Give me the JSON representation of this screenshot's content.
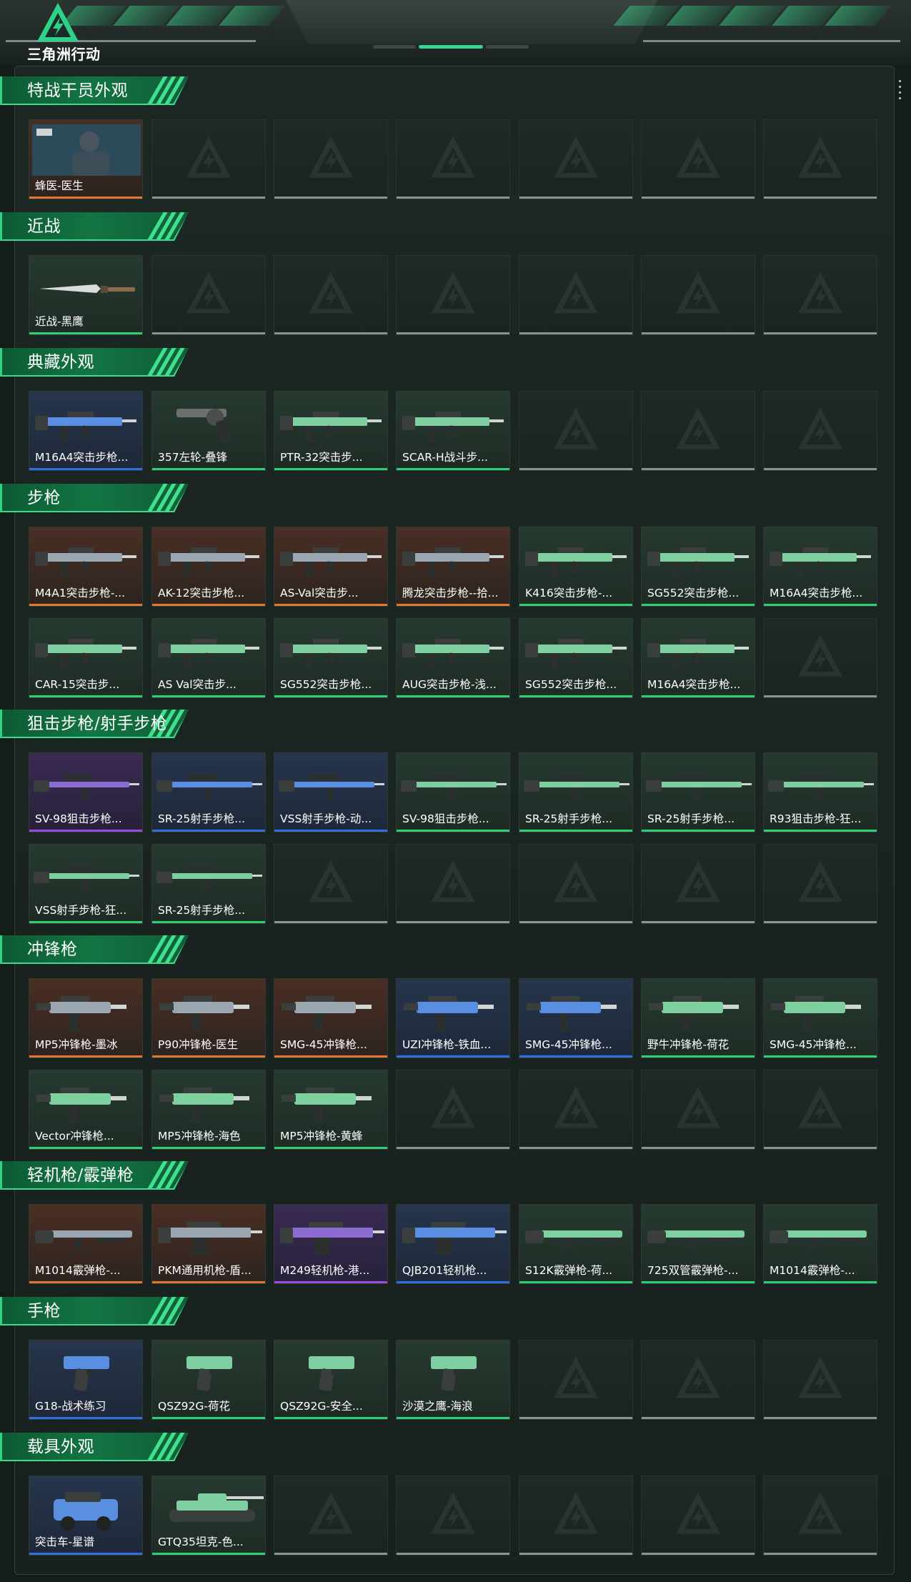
{
  "app": {
    "logo_text": "三角洲行动"
  },
  "colors": {
    "accent": "#37d38f",
    "quality_orange": "#e2782f",
    "quality_purple": "#9b4ce0",
    "quality_blue": "#2f6fe0",
    "quality_green": "#2fcf7a",
    "empty_bar": "#8a9590"
  },
  "sections": [
    {
      "title": "特战干员外观",
      "rows": [
        [
          {
            "name": "蜂医-医生",
            "q": "orange",
            "icon": "operator-portrait"
          },
          null,
          null,
          null,
          null,
          null,
          null
        ]
      ]
    },
    {
      "title": "近战",
      "rows": [
        [
          {
            "name": "近战-黑鹰",
            "q": "green",
            "icon": "knife-icon"
          },
          null,
          null,
          null,
          null,
          null,
          null
        ]
      ]
    },
    {
      "title": "典藏外观",
      "rows": [
        [
          {
            "name": "M16A4突击步枪...",
            "q": "blue",
            "icon": "rifle-icon"
          },
          {
            "name": "357左轮-叠锋",
            "q": "green",
            "icon": "revolver-icon"
          },
          {
            "name": "PTR-32突击步...",
            "q": "green",
            "icon": "rifle-icon"
          },
          {
            "name": "SCAR-H战斗步...",
            "q": "green",
            "icon": "rifle-icon"
          },
          null,
          null,
          null
        ]
      ]
    },
    {
      "title": "步枪",
      "rows": [
        [
          {
            "name": "M4A1突击步枪-...",
            "q": "orange",
            "icon": "rifle-icon"
          },
          {
            "name": "AK-12突击步枪...",
            "q": "orange",
            "icon": "rifle-icon"
          },
          {
            "name": "AS-Val突击步...",
            "q": "orange",
            "icon": "rifle-icon"
          },
          {
            "name": "腾龙突击步枪--拾...",
            "q": "orange",
            "icon": "rifle-icon"
          },
          {
            "name": "K416突击步枪-...",
            "q": "green",
            "icon": "rifle-icon"
          },
          {
            "name": "SG552突击步枪...",
            "q": "green",
            "icon": "rifle-icon"
          },
          {
            "name": "M16A4突击步枪...",
            "q": "green",
            "icon": "rifle-icon"
          }
        ],
        [
          {
            "name": "CAR-15突击步...",
            "q": "green",
            "icon": "rifle-icon"
          },
          {
            "name": "AS Val突击步...",
            "q": "green",
            "icon": "rifle-icon"
          },
          {
            "name": "SG552突击步枪...",
            "q": "green",
            "icon": "rifle-icon"
          },
          {
            "name": "AUG突击步枪-浅...",
            "q": "green",
            "icon": "rifle-icon"
          },
          {
            "name": "SG552突击步枪...",
            "q": "green",
            "icon": "rifle-icon"
          },
          {
            "name": "M16A4突击步枪...",
            "q": "green",
            "icon": "rifle-icon"
          },
          null
        ]
      ]
    },
    {
      "title": "狙击步枪/射手步枪",
      "rows": [
        [
          {
            "name": "SV-98狙击步枪...",
            "q": "purple",
            "icon": "sniper-icon"
          },
          {
            "name": "SR-25射手步枪...",
            "q": "blue",
            "icon": "sniper-icon"
          },
          {
            "name": "VSS射手步枪-动...",
            "q": "blue",
            "icon": "sniper-icon"
          },
          {
            "name": "SV-98狙击步枪...",
            "q": "green",
            "icon": "sniper-icon"
          },
          {
            "name": "SR-25射手步枪...",
            "q": "green",
            "icon": "sniper-icon"
          },
          {
            "name": "SR-25射手步枪...",
            "q": "green",
            "icon": "sniper-icon"
          },
          {
            "name": "R93狙击步枪-狂...",
            "q": "green",
            "icon": "sniper-icon"
          }
        ],
        [
          {
            "name": "VSS射手步枪-狂...",
            "q": "green",
            "icon": "sniper-icon"
          },
          {
            "name": "SR-25射手步枪...",
            "q": "green",
            "icon": "sniper-icon"
          },
          null,
          null,
          null,
          null,
          null
        ]
      ]
    },
    {
      "title": "冲锋枪",
      "rows": [
        [
          {
            "name": "MP5冲锋枪-墨冰",
            "q": "orange",
            "icon": "smg-icon"
          },
          {
            "name": "P90冲锋枪-医生",
            "q": "orange",
            "icon": "smg-icon"
          },
          {
            "name": "SMG-45冲锋枪...",
            "q": "orange",
            "icon": "smg-icon"
          },
          {
            "name": "UZI冲锋枪-铁血...",
            "q": "blue",
            "icon": "smg-icon"
          },
          {
            "name": "SMG-45冲锋枪...",
            "q": "blue",
            "icon": "smg-icon"
          },
          {
            "name": "野牛冲锋枪-荷花",
            "q": "green",
            "icon": "smg-icon"
          },
          {
            "name": "SMG-45冲锋枪...",
            "q": "green",
            "icon": "smg-icon"
          }
        ],
        [
          {
            "name": "Vector冲锋枪...",
            "q": "green",
            "icon": "smg-icon"
          },
          {
            "name": "MP5冲锋枪-海色",
            "q": "green",
            "icon": "smg-icon"
          },
          {
            "name": "MP5冲锋枪-黄蜂",
            "q": "green",
            "icon": "smg-icon"
          },
          null,
          null,
          null,
          null
        ]
      ]
    },
    {
      "title": "轻机枪/霰弹枪",
      "rows": [
        [
          {
            "name": "M1014霰弹枪-...",
            "q": "orange",
            "icon": "shotgun-icon"
          },
          {
            "name": "PKM通用机枪-盾...",
            "q": "orange",
            "icon": "lmg-icon"
          },
          {
            "name": "M249轻机枪-港...",
            "q": "purple",
            "icon": "lmg-icon"
          },
          {
            "name": "QJB201轻机枪...",
            "q": "blue",
            "icon": "lmg-icon"
          },
          {
            "name": "S12K霰弹枪-荷...",
            "q": "green",
            "icon": "shotgun-icon"
          },
          {
            "name": "725双管霰弹枪-...",
            "q": "green",
            "icon": "shotgun-icon"
          },
          {
            "name": "M1014霰弹枪-...",
            "q": "green",
            "icon": "shotgun-icon"
          }
        ]
      ]
    },
    {
      "title": "手枪",
      "rows": [
        [
          {
            "name": "G18-战术练习",
            "q": "blue",
            "icon": "pistol-icon"
          },
          {
            "name": "QSZ92G-荷花",
            "q": "green",
            "icon": "pistol-icon"
          },
          {
            "name": "QSZ92G-安全...",
            "q": "green",
            "icon": "pistol-icon"
          },
          {
            "name": "沙漠之鹰-海浪",
            "q": "green",
            "icon": "pistol-icon"
          },
          null,
          null,
          null
        ]
      ]
    },
    {
      "title": "载具外观",
      "rows": [
        [
          {
            "name": "突击车-星谱",
            "q": "blue",
            "icon": "vehicle-icon"
          },
          {
            "name": "GTQ35坦克-色...",
            "q": "green",
            "icon": "tank-icon"
          },
          null,
          null,
          null,
          null,
          null
        ]
      ]
    }
  ]
}
